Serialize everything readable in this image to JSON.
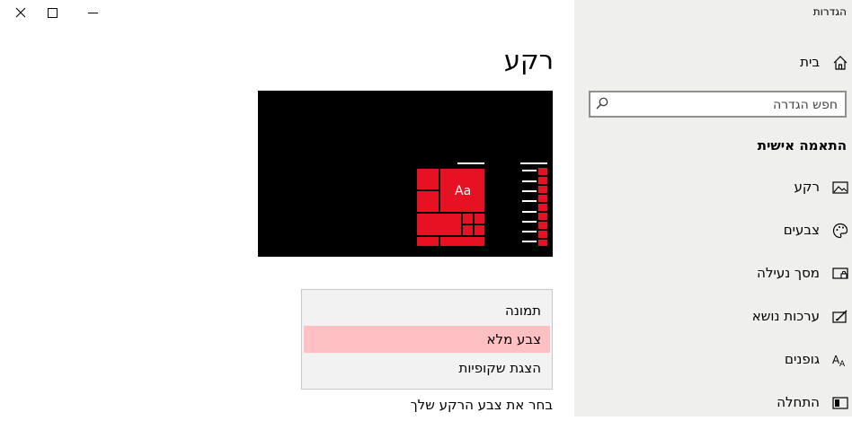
{
  "window": {
    "title": "הגדרות",
    "controls": {
      "close_icon": "close-icon",
      "maximize_icon": "maximize-icon",
      "minimize_icon": "minimize-icon"
    }
  },
  "sidebar": {
    "home_label": "בית",
    "search_placeholder": "חפש הגדרה",
    "section_title": "התאמה אישית",
    "items": [
      {
        "label": "רקע",
        "icon": "image-icon"
      },
      {
        "label": "צבעים",
        "icon": "palette-icon"
      },
      {
        "label": "מסך נעילה",
        "icon": "lock-screen-icon"
      },
      {
        "label": "ערכות נושא",
        "icon": "themes-icon"
      },
      {
        "label": "גופנים",
        "icon": "fonts-icon"
      },
      {
        "label": "התחלה",
        "icon": "start-icon"
      }
    ]
  },
  "main": {
    "title": "רקע",
    "preview": {
      "sample_text": "Aa",
      "accent_color": "#e81123",
      "background_color": "#000000"
    },
    "background_dropdown": {
      "options": [
        "תמונה",
        "צבע מלא",
        "הצגת שקופיות"
      ],
      "selected": "צבע מלא"
    },
    "color_section_label": "בחר את צבע הרקע שלך"
  },
  "colors": {
    "accent": "#e81123",
    "sidebar_bg": "#eff0ee",
    "selected_option_bg": "#ffc0c4"
  }
}
